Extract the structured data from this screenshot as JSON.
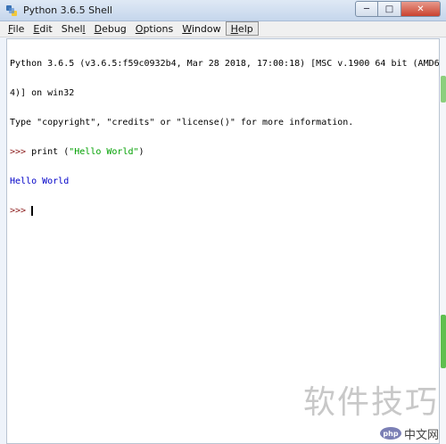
{
  "window": {
    "title": "Python 3.6.5 Shell",
    "min_glyph": "─",
    "max_glyph": "□",
    "close_glyph": "✕"
  },
  "menubar": {
    "items": [
      {
        "key": "F",
        "rest": "ile"
      },
      {
        "key": "E",
        "rest": "dit"
      },
      {
        "key": "",
        "prefix": "Shel",
        "key2": "l",
        "rest": ""
      },
      {
        "key": "D",
        "rest": "ebug"
      },
      {
        "key": "O",
        "rest": "ptions"
      },
      {
        "key": "W",
        "rest": "indow"
      },
      {
        "key": "H",
        "rest": "elp"
      }
    ]
  },
  "shell": {
    "banner_line1": "Python 3.6.5 (v3.6.5:f59c0932b4, Mar 28 2018, 17:00:18) [MSC v.1900 64 bit (AMD6",
    "banner_line2": "4)] on win32",
    "banner_line3": "Type \"copyright\", \"credits\" or \"license()\" for more information.",
    "prompt": ">>> ",
    "cmd_prefix": "print (",
    "cmd_string": "\"Hello World\"",
    "cmd_suffix": ")",
    "output": "Hello World",
    "prompt2": ">>> "
  },
  "watermark": {
    "text": "软件技巧",
    "php_logo": "php",
    "php_text": "中文网"
  },
  "colors": {
    "prompt": "#8b1b1b",
    "string": "#00a000",
    "output": "#0000c8"
  }
}
